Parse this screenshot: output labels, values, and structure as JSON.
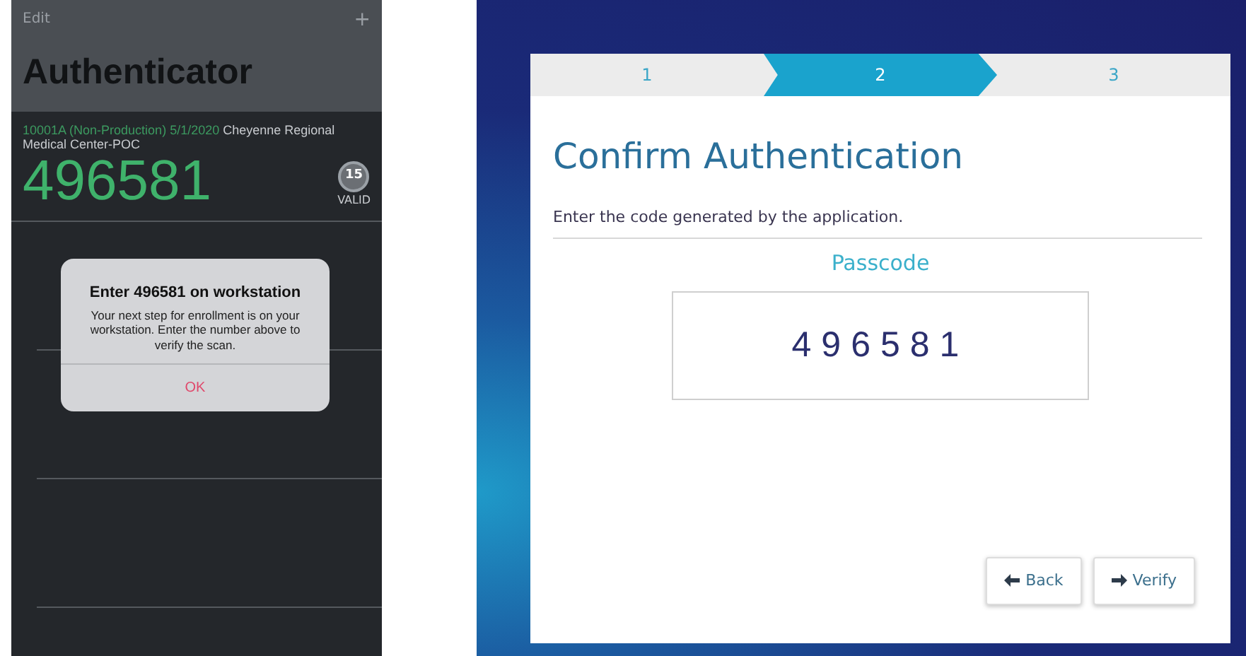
{
  "phone": {
    "edit_label": "Edit",
    "add_label": "+",
    "title": "Authenticator",
    "account": {
      "id": "10001A (Non-Production) 5/1/2020",
      "name": "Cheyenne Regional Medical Center-POC"
    },
    "code": "496581",
    "timer": {
      "seconds": "15",
      "label": "VALID"
    },
    "alert": {
      "title": "Enter 496581 on workstation",
      "message": "Your next step for enrollment is on your workstation.  Enter the number above to verify the scan.",
      "button": "OK"
    }
  },
  "wizard": {
    "steps": [
      {
        "label": "1",
        "selected": false
      },
      {
        "label": "2",
        "selected": true
      },
      {
        "label": "3",
        "selected": false
      }
    ],
    "title": "Confirm Authentication",
    "instruction": "Enter the code generated by the application.",
    "field": {
      "label": "Passcode",
      "value": "496581"
    },
    "buttons": [
      {
        "label": "Back",
        "kind": "back"
      },
      {
        "label": "Verify",
        "kind": "verify"
      }
    ]
  }
}
